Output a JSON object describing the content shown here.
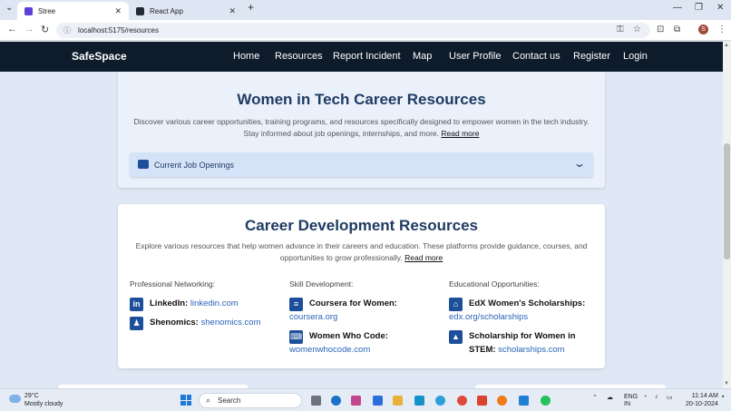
{
  "browser": {
    "tabs": [
      {
        "title": "Stree",
        "favicon_color": "#5b3fd6"
      },
      {
        "title": "React App",
        "favicon_color": "#1f2a36"
      }
    ],
    "url": "localhost:5175/resources"
  },
  "navbar": {
    "brand": "SafeSpace",
    "links": [
      "Home",
      "Resources",
      "Report Incident",
      "Map",
      "User Profile",
      "Contact us",
      "Register",
      "Login"
    ]
  },
  "women_in_tech": {
    "title": "Women in Tech Career Resources",
    "description": "Discover various career opportunities, training programs, and resources specifically designed to empower women in the tech industry. Stay informed about job openings, internships, and more.",
    "read_more": "Read more",
    "accordion_label": "Current Job Openings"
  },
  "career_dev": {
    "title": "Career Development Resources",
    "description": "Explore various resources that help women advance in their careers and education. These platforms provide guidance, courses, and opportunities to grow professionally.",
    "read_more": "Read more",
    "columns": [
      {
        "heading": "Professional Networking:",
        "items": [
          {
            "name": "LinkedIn:",
            "link": "linkedin.com",
            "icon": "linkedin-icon",
            "glyph": "in"
          },
          {
            "name": "Shenomics:",
            "link": "shenomics.com",
            "icon": "user-icon",
            "glyph": "♟"
          }
        ]
      },
      {
        "heading": "Skill Development:",
        "items": [
          {
            "name": "Coursera for Women:",
            "link": "coursera.org",
            "icon": "book-icon",
            "glyph": "≡"
          },
          {
            "name": "Women Who Code:",
            "link": "womenwhocode.com",
            "icon": "laptop-icon",
            "glyph": "⌨"
          }
        ]
      },
      {
        "heading": "Educational Opportunities:",
        "items": [
          {
            "name": "EdX Women's Scholarships:",
            "link": "edx.org/scholarships",
            "icon": "university-icon",
            "glyph": "⌂"
          },
          {
            "name": "Scholarship for Women in STEM:",
            "link": "scholarships.com",
            "icon": "graduation-cap-icon",
            "glyph": "▲"
          }
        ]
      }
    ]
  },
  "taskbar": {
    "temp": "29°C",
    "weather": "Mostly cloudy",
    "search": "Search",
    "lang1": "ENG",
    "lang2": "IN",
    "time": "11:14 AM",
    "date": "20-10-2024"
  },
  "colors": {
    "navbar_bg": "#0d1b2a",
    "heading": "#1f3b63",
    "icon": "#1e4f9a",
    "link": "#2a64b8",
    "accordion_bg": "#d5e3f8"
  }
}
